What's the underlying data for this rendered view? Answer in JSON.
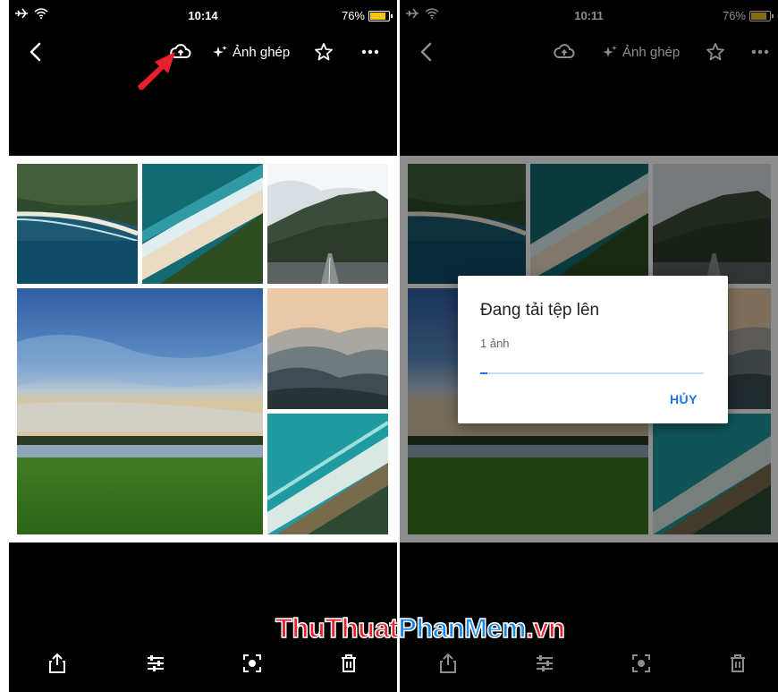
{
  "left_screen": {
    "status": {
      "time": "10:14",
      "battery": "76%",
      "battery_level": 0.76
    },
    "toolbar": {
      "collage_label": "Ảnh ghép"
    }
  },
  "right_screen": {
    "status": {
      "time": "10:11",
      "battery": "76%",
      "battery_level": 0.76
    },
    "toolbar": {
      "collage_label": "Ảnh ghép"
    },
    "dialog": {
      "title": "Đang tải tệp lên",
      "count": "1 ảnh",
      "progress": 0.03,
      "cancel_label": "HỦY"
    }
  },
  "icons": {
    "back": "chevron-left-icon",
    "upload": "cloud-upload-icon",
    "collage": "sparkle-icon",
    "favorite": "star-icon",
    "more": "more-horizontal-icon",
    "share": "share-icon",
    "edit": "sliders-icon",
    "lens": "lens-icon",
    "delete": "trash-icon"
  },
  "colors": {
    "accent": "#1a73e8",
    "battery": "#f7c619",
    "arrow": "#e8212d"
  },
  "watermark": {
    "part1": "ThuThuat",
    "part2": "PhanMem",
    "part3": ".vn"
  }
}
